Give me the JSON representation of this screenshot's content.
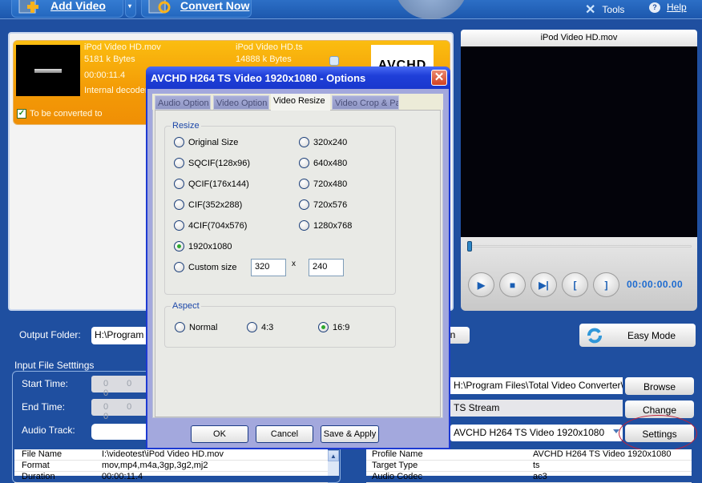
{
  "toolbar": {
    "add_video": "Add Video",
    "convert_now": "Convert Now",
    "tools": "Tools",
    "help": "Help"
  },
  "file_item": {
    "source_name": "iPod Video HD.mov",
    "source_size": "5181 k Bytes",
    "duration": "00:00:11.4",
    "decoder": "Internal decoder",
    "target_name": "iPod Video HD.ts",
    "target_size": "14888 k Bytes",
    "checkbox_label": "To be converted to",
    "checked": true,
    "target_logo": "AVCHD"
  },
  "preview": {
    "title": "iPod Video HD.mov",
    "timecode": "00:00:00.00",
    "seek_position": 0,
    "buttons": [
      "play",
      "stop",
      "next-frame",
      "mark-in",
      "mark-out"
    ],
    "mark_in_glyph": "[",
    "mark_out_glyph": "]"
  },
  "output": {
    "label": "Output Folder:",
    "folder": "H:\\Program Files\\Total Video Converter\\Converted\\",
    "open_label": "en",
    "easy_mode": "Easy Mode"
  },
  "input_settings": {
    "group_label": "Input File Setttings",
    "start_time_label": "Start Time:",
    "start_time_value": "0 0 0",
    "end_time_label": "End Time:",
    "end_time_value": "0 0 0",
    "audio_track_label": "Audio Track:",
    "audio_track_value": "",
    "info_rows": [
      {
        "key": "File Name",
        "value": "I:\\videotest\\iPod Video HD.mov"
      },
      {
        "key": "Format",
        "value": "mov,mp4,m4a,3gp,3g2,mj2"
      },
      {
        "key": "Duration",
        "value": "00:00:11.4"
      }
    ]
  },
  "output_settings": {
    "dest_path": "H:\\Program Files\\Total Video Converter\\Converted",
    "target_type": "TS Stream",
    "profile": "AVCHD H264 TS Video 1920x1080",
    "browse": "Browse",
    "change": "Change",
    "settings": "Settings",
    "info_rows": [
      {
        "key": "Profile Name",
        "value": "AVCHD H264 TS Video 1920x1080"
      },
      {
        "key": "Target Type",
        "value": "ts"
      },
      {
        "key": "Audio Codec",
        "value": "ac3"
      }
    ]
  },
  "dialog": {
    "title": "AVCHD H264 TS Video 1920x1080 - Options",
    "close_glyph": "✕",
    "tabs": [
      {
        "label": "Audio Option",
        "active": false
      },
      {
        "label": "Video Option",
        "active": false
      },
      {
        "label": "Video Resize",
        "active": true
      },
      {
        "label": "Video Crop & Pad",
        "active": false
      }
    ],
    "resize_group": "Resize",
    "resize_options_left": [
      "Original Size",
      "SQCIF(128x96)",
      "QCIF(176x144)",
      "CIF(352x288)",
      "4CIF(704x576)",
      "1920x1080",
      "Custom size"
    ],
    "resize_options_right": [
      "320x240",
      "640x480",
      "720x480",
      "720x576",
      "1280x768"
    ],
    "selected_resize": "1920x1080",
    "custom_width": "320",
    "custom_height": "240",
    "times_glyph": "x",
    "aspect_group": "Aspect",
    "aspect_options": [
      "Normal",
      "4:3",
      "16:9"
    ],
    "selected_aspect": "16:9",
    "ok": "OK",
    "cancel": "Cancel",
    "save_apply": "Save & Apply"
  },
  "colors": {
    "app_blue": "#1f4fa0",
    "file_item_orange": "#f39a06",
    "dialog_title_blue": "#1f3fd9",
    "timecode_blue": "#1d6bd0",
    "highlight_circle": "#c0203a"
  }
}
